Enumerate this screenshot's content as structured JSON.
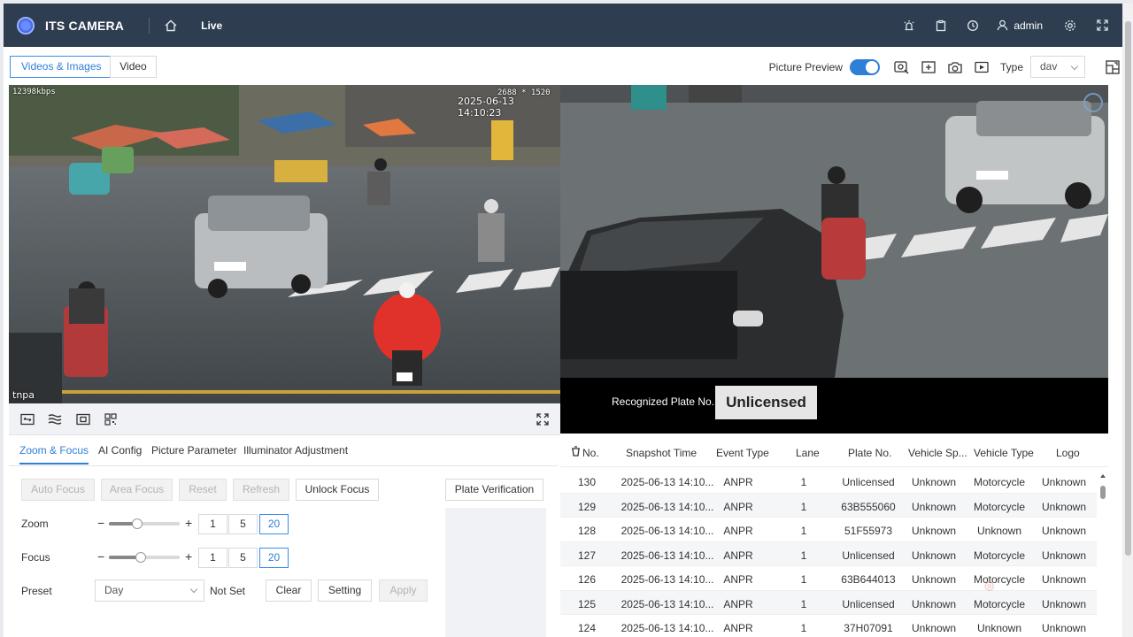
{
  "header": {
    "app_title": "ITS CAMERA",
    "nav_live": "Live",
    "user": "admin"
  },
  "toolbar": {
    "tab_videos_images": "Videos & Images",
    "tab_video": "Video",
    "picture_preview_label": "Picture Preview",
    "picture_preview_on": true,
    "type_label": "Type",
    "type_value": "dav"
  },
  "video_left": {
    "bitrate": "12398kbps",
    "resolution": "2688 * 1520",
    "timestamp": "2025-06-13 14:10:23",
    "label": "tnpa"
  },
  "video_right": {
    "recognized_label": "Recognized Plate No.",
    "recognized_value": "Unlicensed"
  },
  "settings": {
    "tabs": [
      "Zoom & Focus",
      "AI Config",
      "Picture Parameter",
      "Illuminator Adjustment"
    ],
    "buttons": {
      "auto_focus": "Auto Focus",
      "area_focus": "Area Focus",
      "reset": "Reset",
      "refresh": "Refresh",
      "unlock_focus": "Unlock Focus",
      "plate_verification": "Plate Verification"
    },
    "zoom": {
      "label": "Zoom",
      "minus": "−",
      "plus": "+",
      "steps": [
        "1",
        "5",
        "20"
      ],
      "level": 0.4
    },
    "focus": {
      "label": "Focus",
      "minus": "−",
      "plus": "+",
      "steps": [
        "1",
        "5",
        "20"
      ],
      "level": 0.45
    },
    "preset": {
      "label": "Preset",
      "value": "Day",
      "status": "Not Set",
      "clear": "Clear",
      "setting": "Setting",
      "apply": "Apply"
    }
  },
  "table": {
    "columns": [
      "No.",
      "Snapshot Time",
      "Event Type",
      "Lane",
      "Plate No.",
      "Vehicle Sp...",
      "Vehicle Type",
      "Logo"
    ],
    "rows": [
      [
        "130",
        "2025-06-13 14:10...",
        "ANPR",
        "1",
        "Unlicensed",
        "Unknown",
        "Motorcycle",
        "Unknown"
      ],
      [
        "129",
        "2025-06-13 14:10...",
        "ANPR",
        "1",
        "63B555060",
        "Unknown",
        "Motorcycle",
        "Unknown"
      ],
      [
        "128",
        "2025-06-13 14:10...",
        "ANPR",
        "1",
        "51F55973",
        "Unknown",
        "Unknown",
        "Unknown"
      ],
      [
        "127",
        "2025-06-13 14:10...",
        "ANPR",
        "1",
        "Unlicensed",
        "Unknown",
        "Motorcycle",
        "Unknown"
      ],
      [
        "126",
        "2025-06-13 14:10...",
        "ANPR",
        "1",
        "63B644013",
        "Unknown",
        "Motorcycle",
        "Unknown"
      ],
      [
        "125",
        "2025-06-13 14:10...",
        "ANPR",
        "1",
        "Unlicensed",
        "Unknown",
        "Motorcycle",
        "Unknown"
      ],
      [
        "124",
        "2025-06-13 14:10...",
        "ANPR",
        "1",
        "37H07091",
        "Unknown",
        "Unknown",
        "Unknown"
      ]
    ]
  },
  "colors": {
    "header_bg": "#2e3e50",
    "accent": "#2f7ed8"
  }
}
